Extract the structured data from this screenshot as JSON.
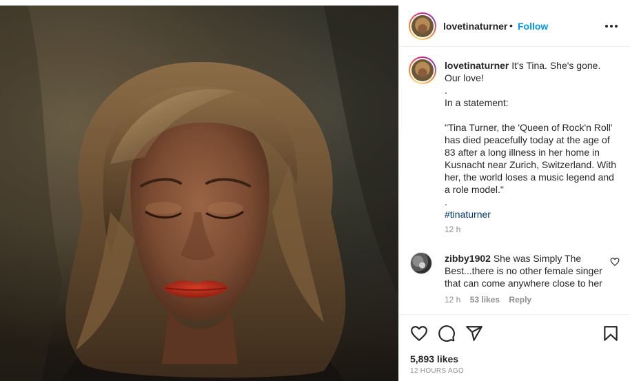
{
  "post": {
    "username": "lovetinaturner",
    "separator": "•",
    "follow_label": "Follow",
    "more_icon": "more-options-icon",
    "photo_alt": "Tina Turner portrait with eyes closed",
    "caption": {
      "username": "lovetinaturner",
      "body": " It's Tina. She's gone.\nOur love!\n.\nIn a statement:\n\n\"Tina Turner, the 'Queen of Rock'n Roll' has died peacefully today at the age of 83 after a long illness in her home in Kusnacht near Zurich, Switzerland. With her, the world loses a music legend and a role model.\"\n.\n",
      "hashtag": "#tinaturner",
      "time": "12 h"
    },
    "comment": {
      "username": "zibby1902",
      "text": " She was Simply The Best...there is no other female singer that can come anywhere close to her",
      "time": "12 h",
      "likes": "53 likes",
      "reply_label": "Reply"
    },
    "actions": {
      "icons": [
        "heart-icon",
        "comment-icon",
        "share-icon",
        "bookmark-icon"
      ]
    },
    "likes_count": "5,893 likes",
    "time_ago": "12 HOURS AGO"
  },
  "colors": {
    "accent": "#0095f6",
    "text": "#262626",
    "muted": "#8e8e8e",
    "hashtag": "#00376b",
    "border": "#efefef"
  }
}
